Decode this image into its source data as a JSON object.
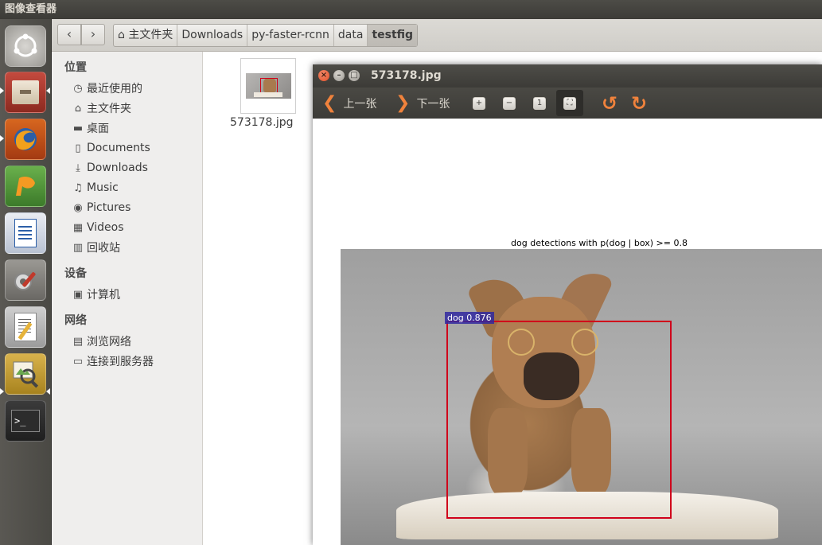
{
  "topbar": {
    "app_title": "图像查看器"
  },
  "launcher": {
    "items": [
      {
        "name": "dash-icon"
      },
      {
        "name": "files-icon"
      },
      {
        "name": "firefox-icon"
      },
      {
        "name": "pycharm-icon"
      },
      {
        "name": "writer-icon"
      },
      {
        "name": "settings-icon"
      },
      {
        "name": "text-editor-icon"
      },
      {
        "name": "image-viewer-icon"
      },
      {
        "name": "terminal-icon"
      }
    ],
    "terminal_glyph": ">_"
  },
  "file_manager": {
    "back_glyph": "‹",
    "forward_glyph": "›",
    "breadcrumbs": [
      "主文件夹",
      "Downloads",
      "py-faster-rcnn",
      "data",
      "testfig"
    ],
    "sidebar": {
      "places_header": "位置",
      "places": [
        {
          "label": "最近使用的",
          "icon": "clock-icon",
          "glyph": "◷"
        },
        {
          "label": "主文件夹",
          "icon": "home-icon",
          "glyph": "⌂"
        },
        {
          "label": "桌面",
          "icon": "desktop-folder-icon",
          "glyph": "▬"
        },
        {
          "label": "Documents",
          "icon": "document-icon",
          "glyph": "▯"
        },
        {
          "label": "Downloads",
          "icon": "download-icon",
          "glyph": "⤓"
        },
        {
          "label": "Music",
          "icon": "music-icon",
          "glyph": "♫"
        },
        {
          "label": "Pictures",
          "icon": "camera-icon",
          "glyph": "◉"
        },
        {
          "label": "Videos",
          "icon": "film-icon",
          "glyph": "▦"
        },
        {
          "label": "回收站",
          "icon": "trash-icon",
          "glyph": "▥"
        }
      ],
      "devices_header": "设备",
      "devices": [
        {
          "label": "计算机",
          "icon": "computer-icon",
          "glyph": "▣"
        }
      ],
      "network_header": "网络",
      "network": [
        {
          "label": "浏览网络",
          "icon": "network-icon",
          "glyph": "▤"
        },
        {
          "label": "连接到服务器",
          "icon": "server-icon",
          "glyph": "▭"
        }
      ]
    },
    "files": [
      {
        "name": "573178.jpg"
      }
    ]
  },
  "viewer": {
    "window_title": "573178.jpg",
    "close_glyph": "×",
    "minimize_glyph": "–",
    "maximize_glyph": "□",
    "prev_label": "上一张",
    "next_label": "下一张",
    "prev_glyph": "❮",
    "next_glyph": "❯",
    "zoom_in_glyph": "+",
    "zoom_out_glyph": "−",
    "normal_size_glyph": "1",
    "best_fit_glyph": "⛶",
    "rotate_left_glyph": "↺",
    "rotate_right_glyph": "↻",
    "figure_title": "dog detections with p(dog | box) >= 0.8",
    "detection_label": "dog 0.876",
    "colors": {
      "box": "#d0021b",
      "label_bg": "#3028a0",
      "accent": "#f0823c"
    }
  }
}
